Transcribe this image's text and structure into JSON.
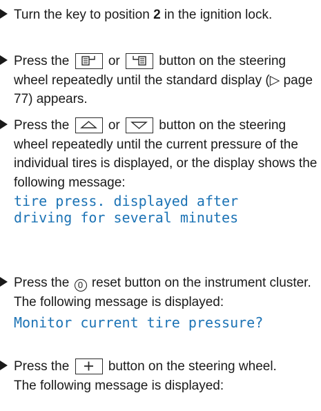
{
  "steps": [
    {
      "pre": "Turn the key to position ",
      "bold": "2",
      "post": " in the ignition lock."
    },
    {
      "pre": "Press the ",
      "icon1": "display-left-icon",
      "mid": " or ",
      "icon2": "display-right-icon",
      "post": " button on the steering wheel repeatedly until the standard display (▷ page 77) appears."
    },
    {
      "pre": "Press the ",
      "icon1": "arrow-up-icon",
      "mid": " or ",
      "icon2": "arrow-down-icon",
      "post": " button on the steering wheel repeatedly until the current pressure of the individual tires is displayed, or the display shows the following message:",
      "message_line1": "tire press. displayed after",
      "message_line2": "driving for several minutes"
    },
    {
      "pre": "Press the ",
      "icon": "reset-0-icon",
      "icon_text": "0",
      "post": " reset button on the instrument cluster.",
      "followup": "The following message is displayed:",
      "message": "Monitor current tire pressure?"
    },
    {
      "pre": "Press the ",
      "icon": "plus-icon",
      "post": " button on the steering wheel.",
      "followup": "The following message is displayed:"
    }
  ],
  "colors": {
    "text": "#1a1a1a",
    "message": "#1c73b5"
  }
}
